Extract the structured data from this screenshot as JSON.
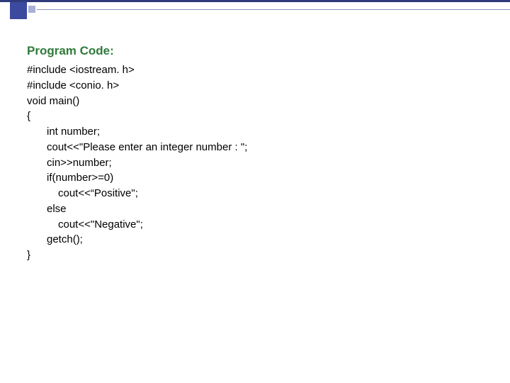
{
  "slide": {
    "heading": "Program Code:",
    "code": {
      "l1": "#include <iostream. h>",
      "l2": "#include <conio. h>",
      "l3": "void main()",
      "l4": "{",
      "l5": "int number;",
      "l6": "cout<<\"Please enter an integer number : \";",
      "l7": "cin>>number;",
      "l8": "if(number>=0)",
      "l9": "cout<<“Positive\";",
      "l10": "else",
      "l11": "cout<<\"Negative\";",
      "l12": "getch();",
      "l13": "}"
    }
  }
}
